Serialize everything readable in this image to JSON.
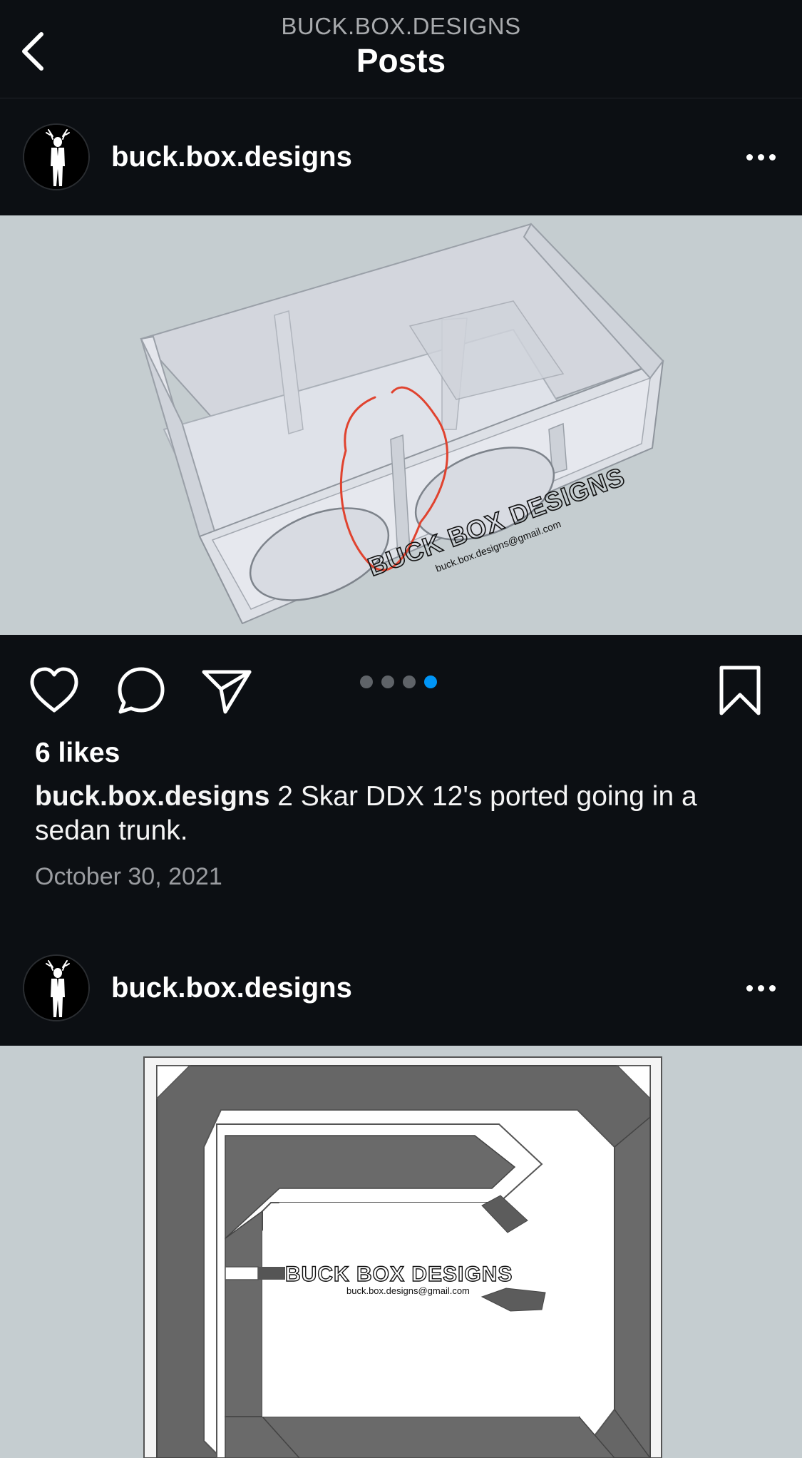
{
  "header": {
    "subtitle": "BUCK.BOX.DESIGNS",
    "title": "Posts"
  },
  "posts": [
    {
      "username": "buck.box.designs",
      "image_logo": {
        "title": "BUCK BOX DESIGNS",
        "email": "buck.box.designs@gmail.com"
      },
      "carousel": {
        "count": 4,
        "active_index": 3
      },
      "likes": "6 likes",
      "caption_user": "buck.box.designs",
      "caption_text": " 2 Skar DDX 12's ported going in a sedan trunk.",
      "date": "October 30, 2021"
    },
    {
      "username": "buck.box.designs",
      "image_logo": {
        "title": "BUCK BOX DESIGNS",
        "email": "buck.box.designs@gmail.com"
      }
    }
  ],
  "icons": {
    "back": "chevron-left-icon",
    "more": "more-horizontal-icon",
    "like": "heart-icon",
    "comment": "comment-bubble-icon",
    "share": "paper-plane-icon",
    "save": "bookmark-icon"
  },
  "colors": {
    "background": "#0c0f13",
    "accent": "#0095f6",
    "media_bg": "#c5cdd0",
    "annotation": "#e0432f"
  }
}
